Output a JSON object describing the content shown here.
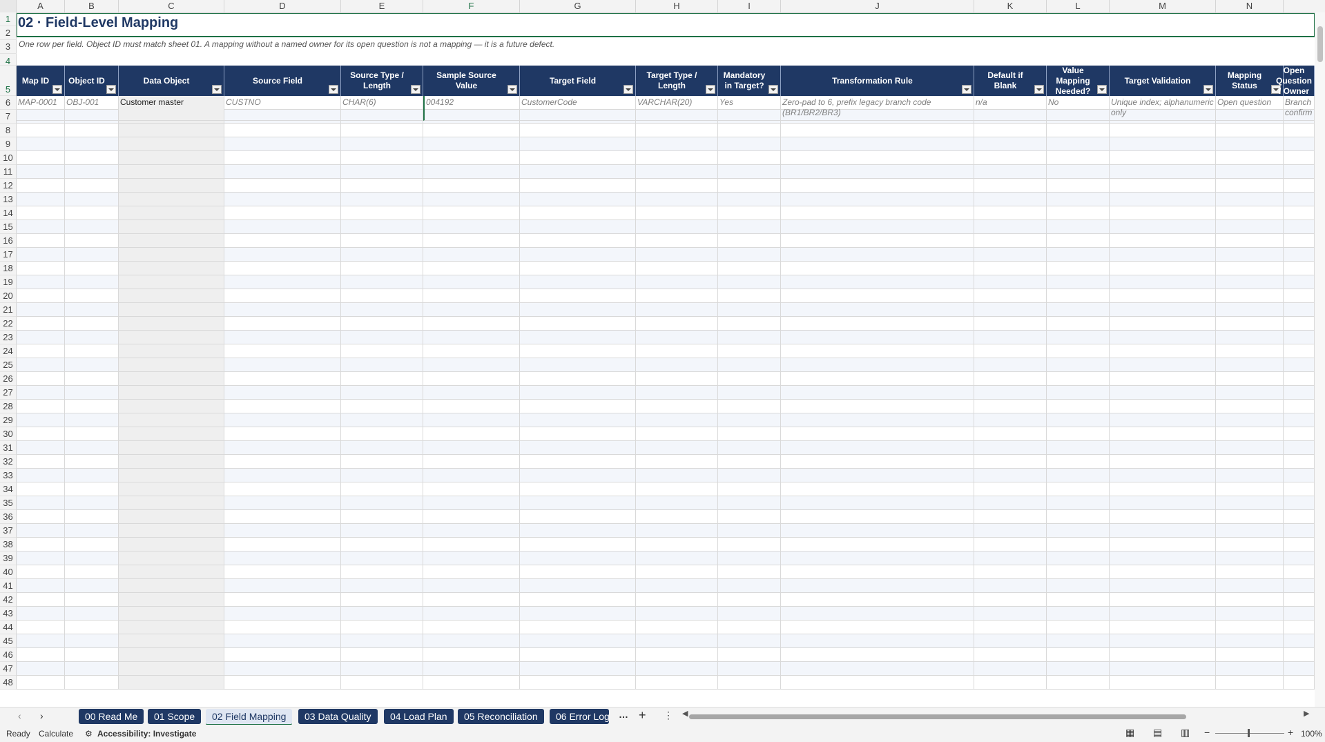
{
  "sheet": {
    "title": "02 · Field-Level Mapping",
    "subtitle": "One row per field. Object ID must match sheet 01. A mapping without a named owner for its open question is not a mapping — it is a future defect."
  },
  "columns": [
    "A",
    "B",
    "C",
    "D",
    "E",
    "F",
    "G",
    "H",
    "I",
    "J",
    "K",
    "L",
    "M",
    "N"
  ],
  "headers": [
    "Map ID",
    "Object ID",
    "Data Object",
    "Source Field",
    "Source Type / Length",
    "Sample Source Value",
    "Target Field",
    "Target Type / Length",
    "Mandatory in Target?",
    "Transformation Rule",
    "Default if Blank",
    "Value Mapping Needed?",
    "Target Validation",
    "Mapping Status",
    "Open Question / Owner"
  ],
  "sample_row": [
    "MAP-0001",
    "OBJ-001",
    "Customer master",
    "CUSTNO",
    "CHAR(6)",
    "004192",
    "CustomerCode",
    "VARCHAR(20)",
    "Yes",
    "Zero-pad to 6, prefix legacy branch code (BR1/BR2/BR3)",
    "n/a",
    "No",
    "Unique index; alphanumeric only",
    "Open question",
    "Branch confirm"
  ],
  "row_numbers_first": 1,
  "row_numbers_last": 48,
  "tabs": [
    "00 Read Me",
    "01 Scope",
    "02 Field Mapping",
    "03 Data Quality",
    "04 Load Plan",
    "05 Reconciliation",
    "06 Error Log"
  ],
  "active_tab": 2,
  "status": {
    "ready": "Ready",
    "calculate": "Calculate",
    "accessibility": "Accessibility: Investigate",
    "zoom": "100%"
  },
  "icons": {
    "prev": "chevron-left-icon",
    "next": "chevron-right-icon",
    "more": "ellipsis-icon",
    "add": "plus-icon",
    "options": "vertical-dots-icon"
  },
  "colors": {
    "header_bg": "#1f3864",
    "accent_green": "#1e7145",
    "band": "#f3f6fb"
  }
}
